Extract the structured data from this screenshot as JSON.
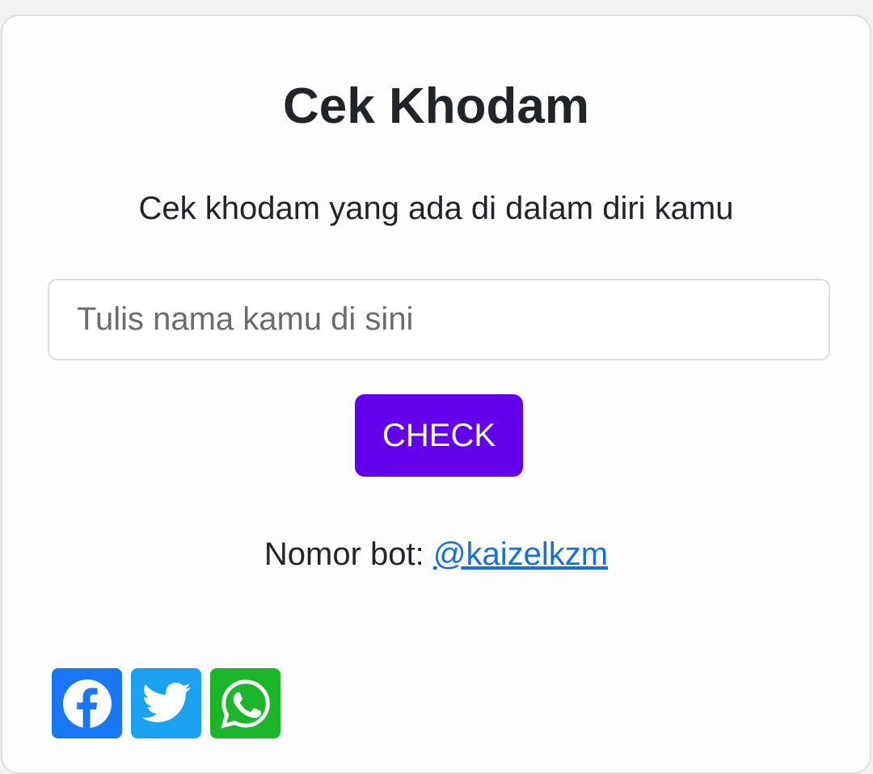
{
  "header": {
    "title": "Cek Khodam",
    "subtitle": "Cek khodam yang ada di dalam diri kamu"
  },
  "form": {
    "name_placeholder": "Tulis nama kamu di sini",
    "name_value": "",
    "check_label": "CHECK"
  },
  "bot": {
    "label": "Nomor bot: ",
    "handle": "@kaizelkzm"
  },
  "share": [
    {
      "icon": "facebook-icon",
      "color": "#1877f2"
    },
    {
      "icon": "twitter-icon",
      "color": "#1da1f2"
    },
    {
      "icon": "whatsapp-icon",
      "color": "#1cb52c"
    }
  ],
  "colors": {
    "accent": "#6200ea",
    "link": "#1a6fd6",
    "text": "#212529"
  }
}
